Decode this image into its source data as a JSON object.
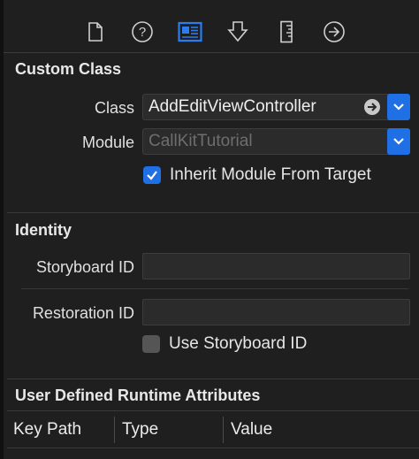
{
  "toolbar": {
    "icons": [
      "file-inspector-icon",
      "quick-help-icon",
      "identity-inspector-icon",
      "attributes-inspector-icon",
      "size-inspector-icon",
      "connections-inspector-icon"
    ],
    "selected": "identity-inspector-icon",
    "accent": "#1f6fe5"
  },
  "custom_class": {
    "title": "Custom Class",
    "class_label": "Class",
    "class_value": "AddEditViewController",
    "module_label": "Module",
    "module_placeholder": "CallKitTutorial",
    "inherit_label": "Inherit Module From Target",
    "inherit_checked": true
  },
  "identity": {
    "title": "Identity",
    "storyboard_id_label": "Storyboard ID",
    "storyboard_id_value": "",
    "restoration_id_label": "Restoration ID",
    "restoration_id_value": "",
    "use_storyboard_label": "Use Storyboard ID",
    "use_storyboard_checked": false
  },
  "runtime_attributes": {
    "title": "User Defined Runtime Attributes",
    "columns": [
      "Key Path",
      "Type",
      "Value"
    ]
  }
}
